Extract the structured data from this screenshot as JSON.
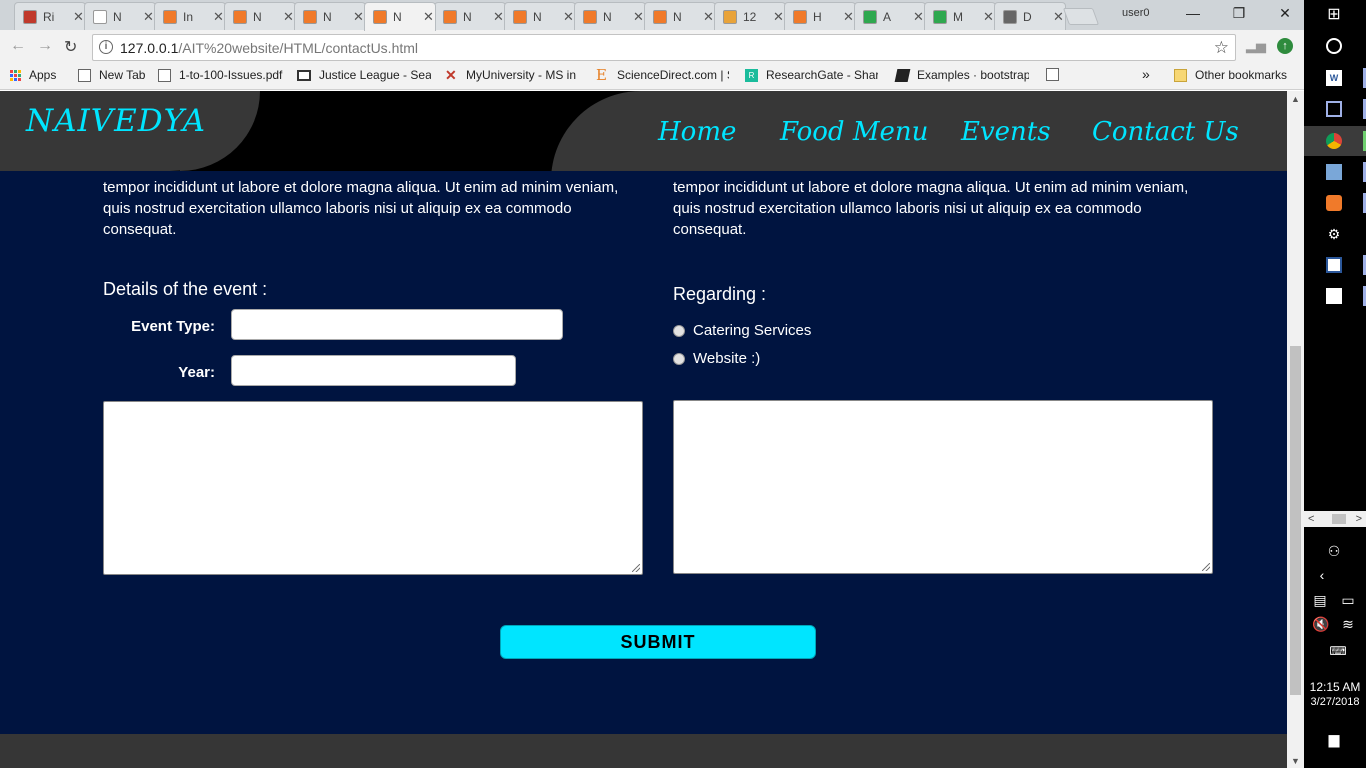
{
  "browser": {
    "tabs": [
      {
        "label": "Ri",
        "favicon_color": "#c0392b"
      },
      {
        "label": "N",
        "favicon_color": "#ffffff"
      },
      {
        "label": "In",
        "favicon_color": "#f07a2a"
      },
      {
        "label": "N",
        "favicon_color": "#f07a2a"
      },
      {
        "label": "N",
        "favicon_color": "#f07a2a"
      },
      {
        "label": "N",
        "favicon_color": "#f07a2a",
        "active": true
      },
      {
        "label": "N",
        "favicon_color": "#f07a2a"
      },
      {
        "label": "N",
        "favicon_color": "#f07a2a"
      },
      {
        "label": "N",
        "favicon_color": "#f07a2a"
      },
      {
        "label": "N",
        "favicon_color": "#f07a2a"
      },
      {
        "label": "12",
        "favicon_color": "#e8a33a"
      },
      {
        "label": "H",
        "favicon_color": "#f07a2a"
      },
      {
        "label": "A",
        "favicon_color": "#2fa84f"
      },
      {
        "label": "M",
        "favicon_color": "#2fa84f"
      },
      {
        "label": "D",
        "favicon_color": "#666666"
      }
    ],
    "tab_close_glyph": "✕",
    "user_label": "user0",
    "window_controls": {
      "minimize": "—",
      "maximize": "❐",
      "close": "✕"
    },
    "address": {
      "host": "127.0.0.1",
      "path": "/AIT%20website/HTML/contactUs.html"
    },
    "bookmarks": [
      {
        "label": "Apps",
        "icon": "apps-grid-icon"
      },
      {
        "label": "New Tab",
        "icon": "page-icon"
      },
      {
        "label": "1-to-100-Issues.pdf",
        "icon": "page-icon"
      },
      {
        "label": "Justice League - Seas",
        "icon": "tv-icon"
      },
      {
        "label": "MyUniversity - MS in",
        "icon": "x-icon"
      },
      {
        "label": "ScienceDirect.com | S",
        "icon": "e-icon"
      },
      {
        "label": "ResearchGate - Share",
        "icon": "rg-icon"
      },
      {
        "label": "Examples · bootstrap",
        "icon": "book-icon"
      },
      {
        "label": "",
        "icon": "page-icon"
      }
    ],
    "bookmarks_overflow": "»",
    "other_bookmarks": "Other bookmarks"
  },
  "site": {
    "brand": "NAIVEDYA",
    "nav": [
      "Home",
      "Food Menu",
      "Events",
      "Contact Us"
    ],
    "paragraph_left": "tempor incididunt ut labore et dolore magna aliqua. Ut enim ad minim veniam, quis nostrud exercitation ullamco laboris nisi ut aliquip ex ea commodo consequat.",
    "paragraph_right": "tempor incididunt ut labore et dolore magna aliqua. Ut enim ad minim veniam, quis nostrud exercitation ullamco laboris nisi ut aliquip ex ea commodo consequat.",
    "event_section_title": "Details of the event :",
    "event_type_label": "Event Type:",
    "event_type_value": "",
    "year_label": "Year:",
    "year_value": "",
    "regarding_title": "Regarding :",
    "regarding_options": [
      "Catering Services",
      "Website :)"
    ],
    "submit_label": "SUBMIT",
    "accent_color": "#00e5ff",
    "page_bg": "#001440"
  },
  "taskbar": {
    "time": "12:15 AM",
    "date": "3/27/2018"
  }
}
